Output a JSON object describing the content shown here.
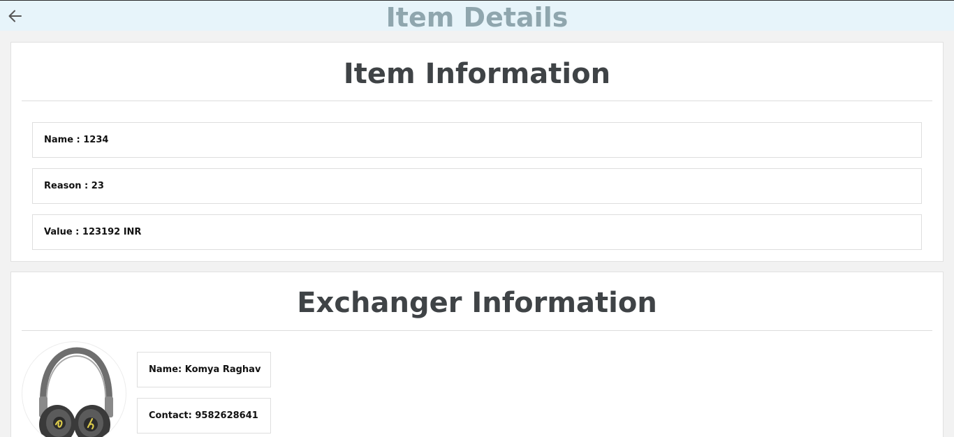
{
  "header": {
    "title": "Item Details",
    "back_icon": "arrow-left-icon",
    "background": "#e7f4fa",
    "title_color": "#8fa6ae"
  },
  "item_info": {
    "title": "Item Information",
    "rows": [
      {
        "text": "Name : 1234"
      },
      {
        "text": "Reason : 23"
      },
      {
        "text": "Value : 123192 INR"
      }
    ]
  },
  "exchanger_info": {
    "title": "Exchanger Information",
    "avatar_icon": "headphones-image",
    "name_text": "Name: Komya Raghav",
    "contact_text": "Contact: 9582628641"
  }
}
